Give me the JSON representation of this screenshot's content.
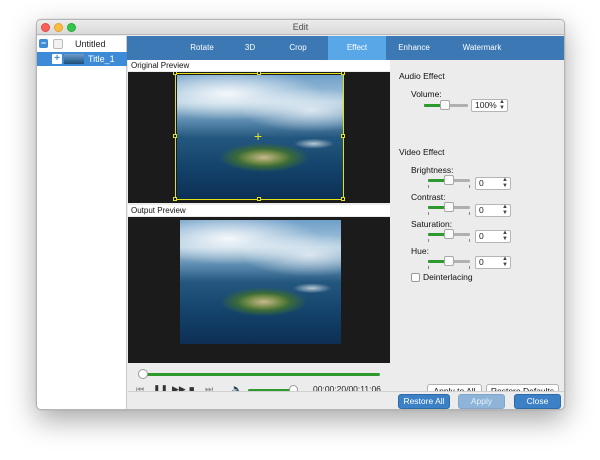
{
  "window": {
    "title": "Edit"
  },
  "sidebar": {
    "items": [
      {
        "label": "Untitled"
      },
      {
        "label": "Title_1"
      }
    ]
  },
  "tabs": [
    {
      "label": "Rotate"
    },
    {
      "label": "3D"
    },
    {
      "label": "Crop"
    },
    {
      "label": "Effect",
      "active": true
    },
    {
      "label": "Enhance"
    },
    {
      "label": "Watermark"
    }
  ],
  "preview": {
    "original_label": "Original Preview",
    "output_label": "Output Preview"
  },
  "player": {
    "time": "00:00:20/00:11:06",
    "progress": 0.0,
    "volume": 0.9
  },
  "audio": {
    "heading": "Audio Effect",
    "volume_label": "Volume:",
    "volume_value": "100%"
  },
  "video": {
    "heading": "Video Effect",
    "brightness_label": "Brightness:",
    "brightness_value": "0",
    "contrast_label": "Contrast:",
    "contrast_value": "0",
    "saturation_label": "Saturation:",
    "saturation_value": "0",
    "hue_label": "Hue:",
    "hue_value": "0",
    "deinterlacing_label": "Deinterlacing"
  },
  "buttons": {
    "apply_to_all": "Apply to All",
    "restore_defaults": "Restore Defaults",
    "restore_all": "Restore All",
    "apply": "Apply",
    "close": "Close"
  },
  "colors": {
    "tab_bar": "#3c79b4",
    "tab_active": "#5aa7e8",
    "accent_green": "#2e9a2e",
    "button_blue": "#3c80c6"
  }
}
